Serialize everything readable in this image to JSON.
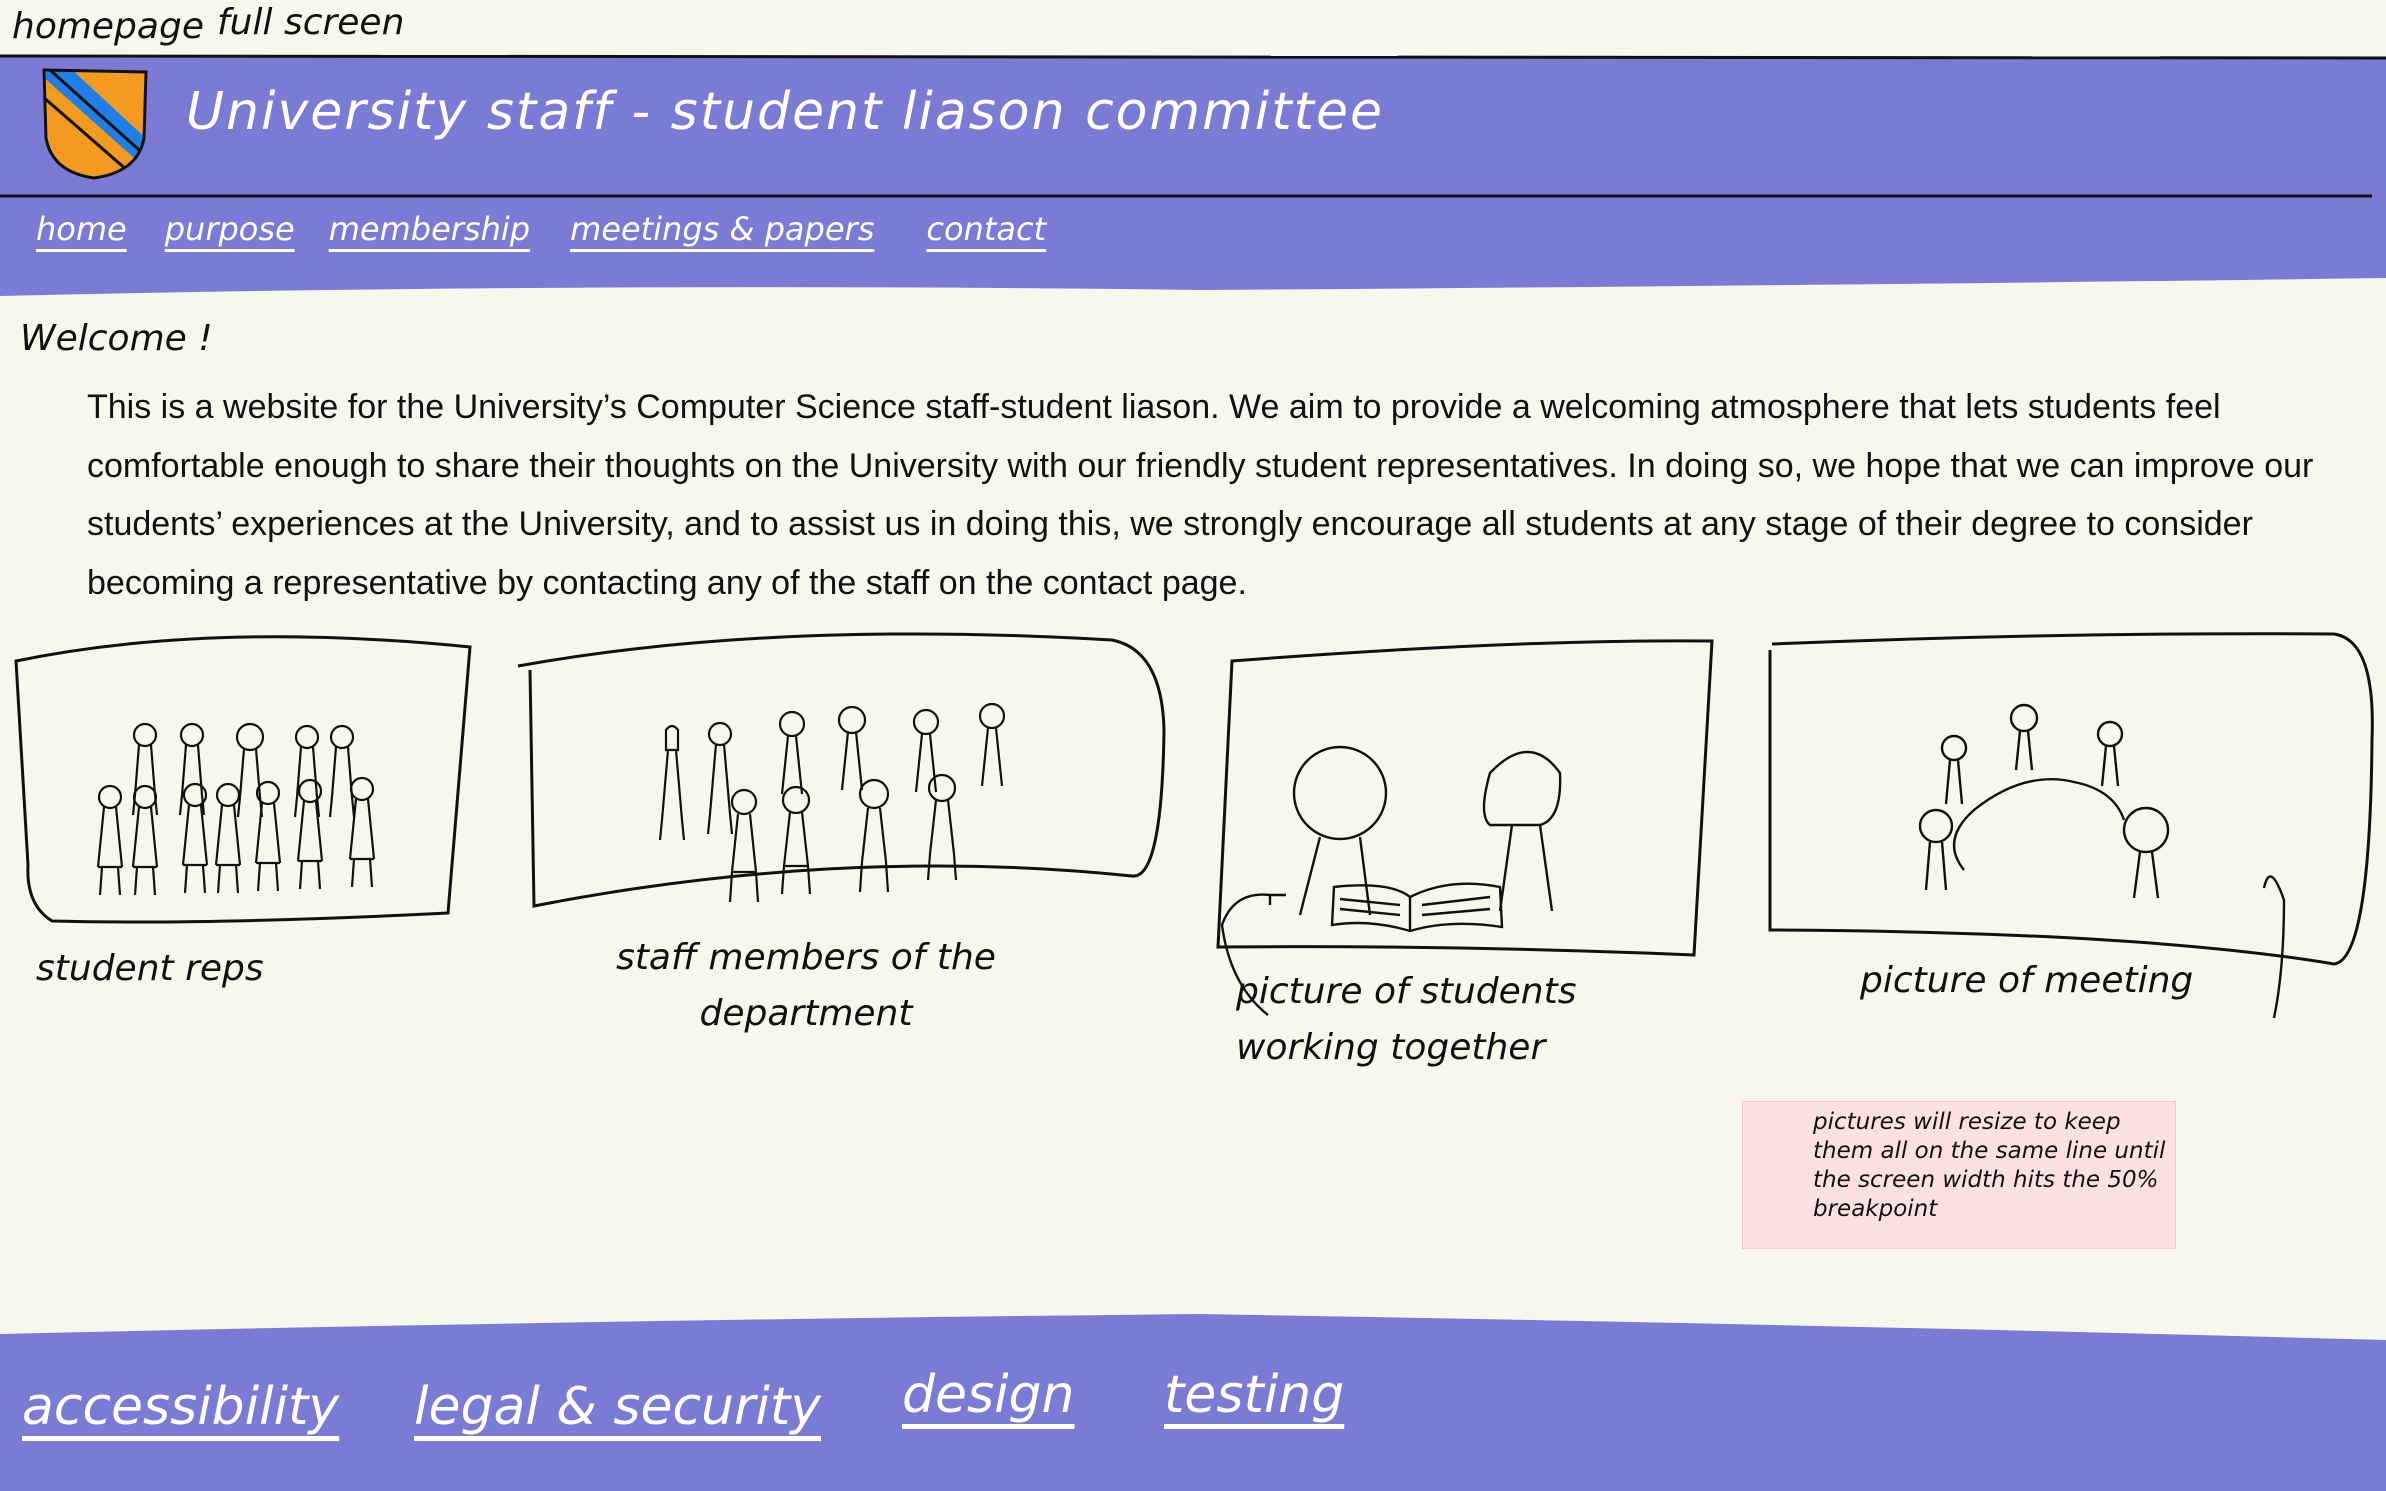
{
  "top_notes": {
    "page_label": "homepage",
    "view_label": "full screen"
  },
  "header": {
    "title": "University staff - student liason committee",
    "nav": [
      {
        "label": "home"
      },
      {
        "label": "purpose"
      },
      {
        "label": "membership"
      },
      {
        "label": "meetings & papers"
      },
      {
        "label": "contact"
      }
    ]
  },
  "colors": {
    "band": "#7b7bd6",
    "page_bg": "#f8f7ec",
    "crest_blue": "#1f7fe6",
    "crest_orange": "#f39a20",
    "note_bg": "#fde0e0"
  },
  "main": {
    "welcome": "Welcome !",
    "intro": "This is a website for the University’s Computer Science staff-student liason. We aim to provide a welcoming atmosphere that lets students feel comfortable enough to share their thoughts on the University with our friendly student representatives. In doing so, we hope that we can improve our students’ experiences at the University, and to assist us in doing this, we strongly encourage all students at any stage of their degree to consider becoming a representative by contacting any of the staff on the contact page.",
    "panels": [
      {
        "caption": "student reps",
        "icon": "student-reps-sketch"
      },
      {
        "caption": "staff members of the department",
        "icon": "staff-members-sketch"
      },
      {
        "caption": "picture of students working together",
        "icon": "students-working-sketch"
      },
      {
        "caption": "picture of meeting",
        "icon": "meeting-sketch"
      }
    ],
    "note": "pictures will resize to keep them all on the same line until the screen width hits the 50% breakpoint"
  },
  "footer": {
    "links": [
      {
        "label": "accessibility"
      },
      {
        "label": "legal & security"
      },
      {
        "label": "design"
      },
      {
        "label": "testing"
      }
    ]
  }
}
